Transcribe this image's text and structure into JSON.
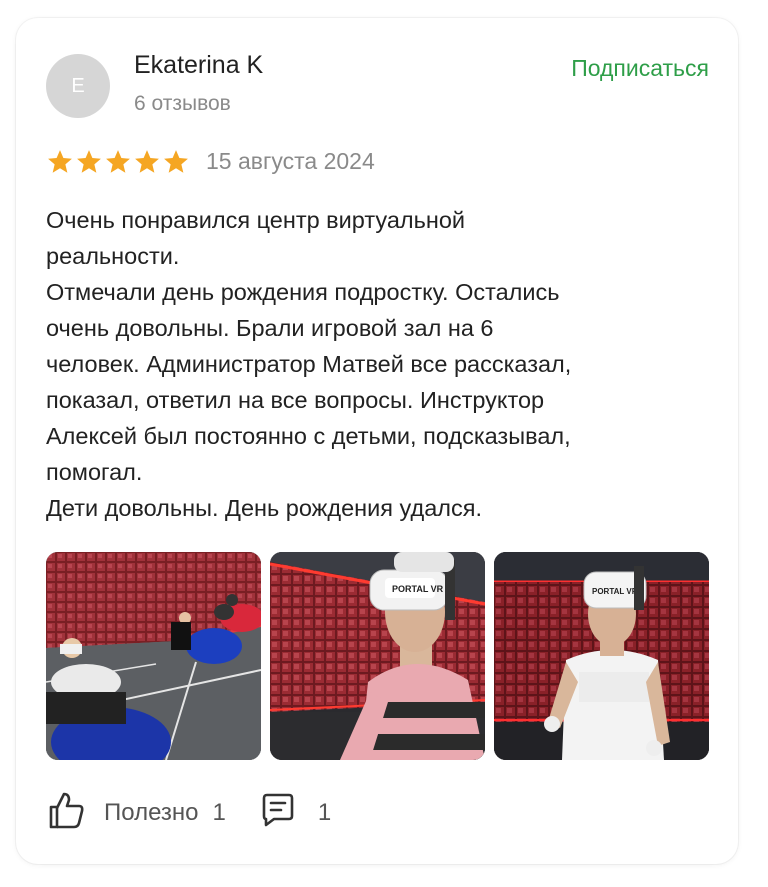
{
  "review": {
    "author": {
      "initial": "E",
      "name": "Ekaterina K",
      "reviews_count": "6 отзывов"
    },
    "subscribe_label": "Подписаться",
    "rating": 5,
    "date": "15 августа 2024",
    "text_lines": [
      "Очень понравился центр виртуальной",
      "реальности.",
      "Отмечали день рождения подростку. Остались",
      "очень довольны. Брали игровой зал на 6",
      "человек. Администратор Матвей все рассказал,",
      "показал, ответил на все вопросы. Инструктор",
      "Алексей был постоянно с детьми, подсказывал,",
      "помогал.",
      "Дети довольны. День рождения удался."
    ],
    "photos": [
      {
        "name": "vr-room-beanbags-photo"
      },
      {
        "name": "teen-vr-headset-striped-shirt-photo",
        "headset_text": "PORTAL VR"
      },
      {
        "name": "teen-vr-headset-white-shirt-photo",
        "headset_text": "PORTAL VR"
      }
    ],
    "actions": {
      "useful_label": "Полезно",
      "useful_count": "1",
      "comments_count": "1"
    }
  },
  "colors": {
    "accent": "#2e9e48",
    "star": "#f5a623",
    "muted": "#8a8a8a"
  }
}
